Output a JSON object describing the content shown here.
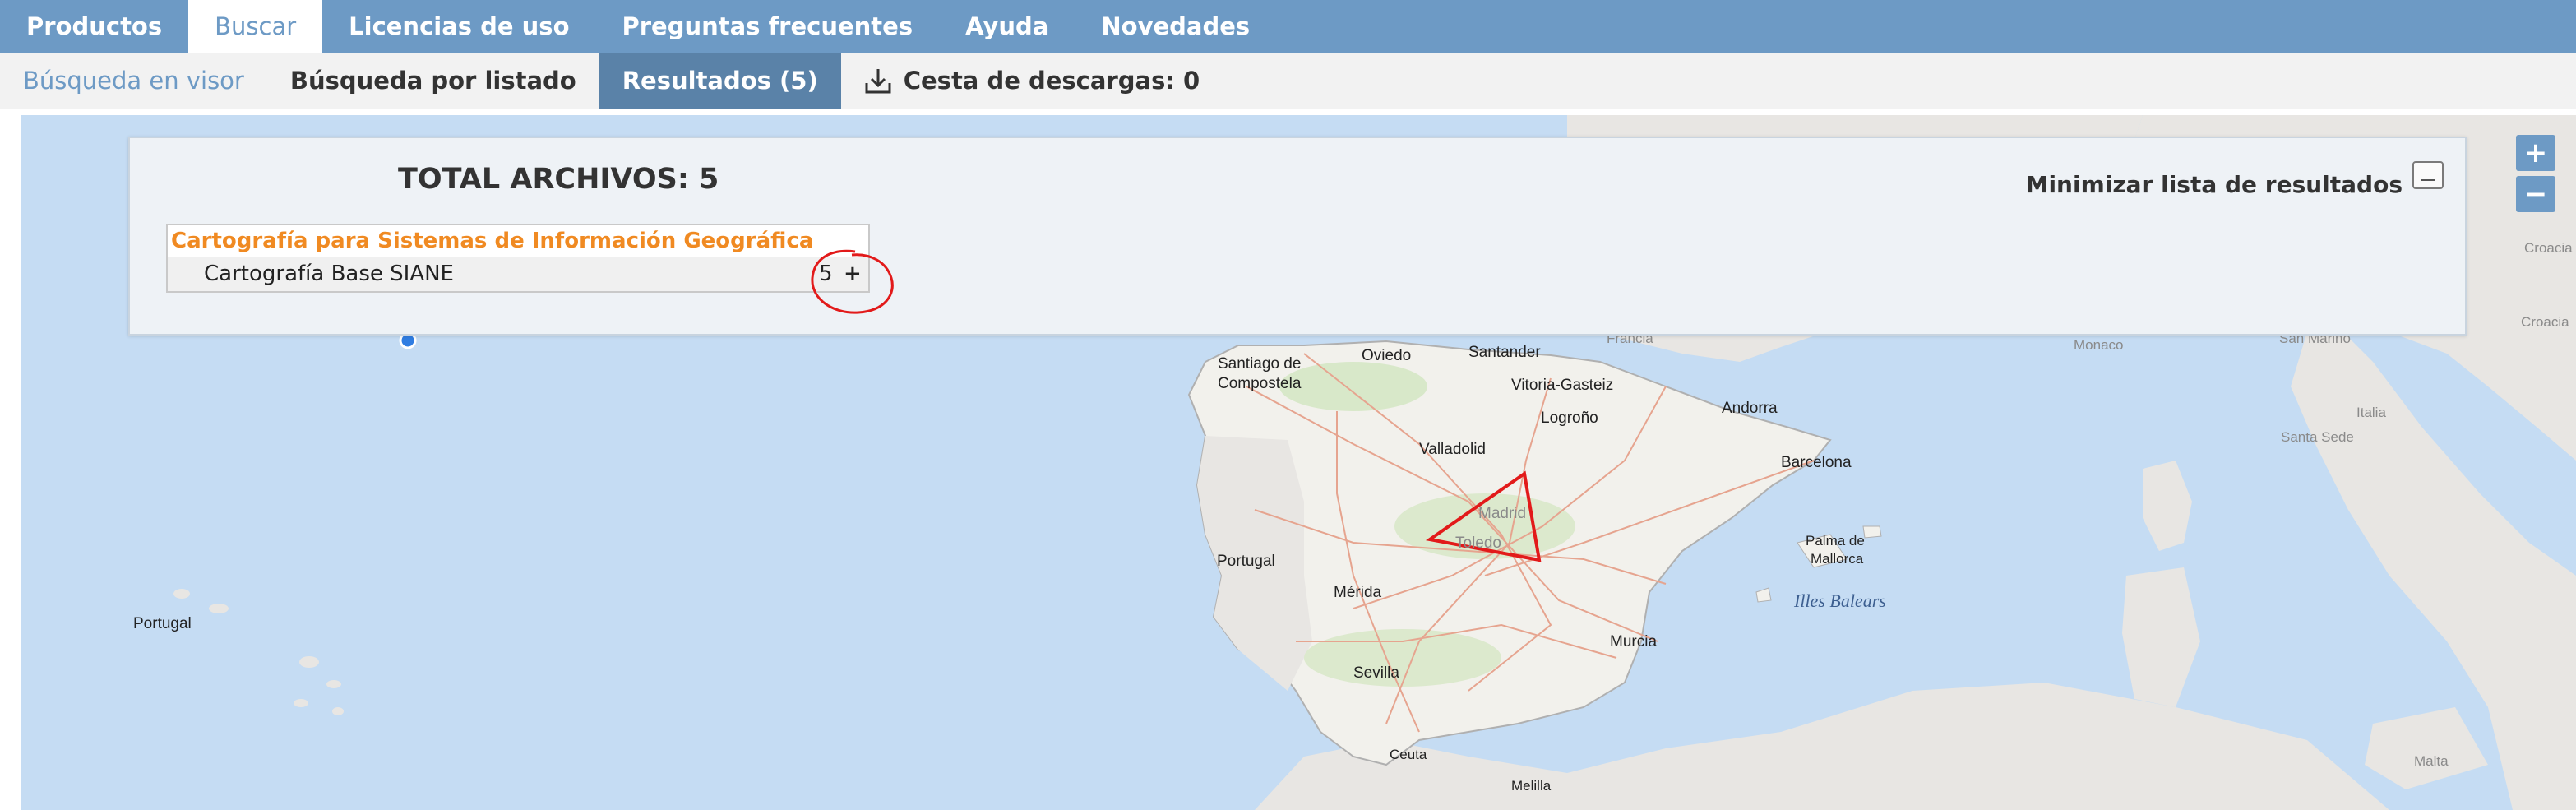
{
  "nav": {
    "items": [
      "Productos",
      "Buscar",
      "Licencias de uso",
      "Preguntas frecuentes",
      "Ayuda",
      "Novedades"
    ],
    "active": "Buscar"
  },
  "subnav": {
    "viewer_search": "Búsqueda en visor",
    "list_search": "Búsqueda por listado",
    "results": "Resultados (5)",
    "cart": "Cesta de descargas: 0"
  },
  "panel": {
    "total": "TOTAL ARCHIVOS: 5",
    "minimize": "Minimizar lista de resultados",
    "category": "Cartografía para Sistemas de Información Geográfica",
    "row": {
      "name": "Cartografía Base SIANE",
      "count": "5",
      "expand": "+"
    }
  },
  "map": {
    "zoom_in": "+",
    "zoom_out": "−",
    "labels": {
      "santiago1": "Santiago de",
      "santiago2": "Compostela",
      "oviedo": "Oviedo",
      "santander": "Santander",
      "vitoria": "Vitoria-Gasteiz",
      "logrono": "Logroño",
      "valladolid": "Valladolid",
      "andorra": "Andorra",
      "barcelona": "Barcelona",
      "madrid": "Madrid",
      "toledo": "Toledo",
      "portugal": "Portugal",
      "portugal_atl": "Portugal",
      "merida": "Mérida",
      "palma1": "Palma de",
      "palma2": "Mallorca",
      "illes": "Illes Balears",
      "murcia": "Murcia",
      "sevilla": "Sevilla",
      "ceuta": "Ceuta",
      "melilla": "Melilla",
      "francia": "Francia",
      "monaco": "Monaco",
      "italia": "Italia",
      "santa_sede": "Santa Sede",
      "croacia": "Croacia",
      "croacia2": "Croacia",
      "san_marino": "San Marino",
      "malta": "Malta"
    }
  },
  "colors": {
    "nav_bg": "#6d9ac5",
    "results_tab": "#5a82a8",
    "category": "#f08a22",
    "annotation": "#e21a1a",
    "sea": "#c5dcf3"
  }
}
